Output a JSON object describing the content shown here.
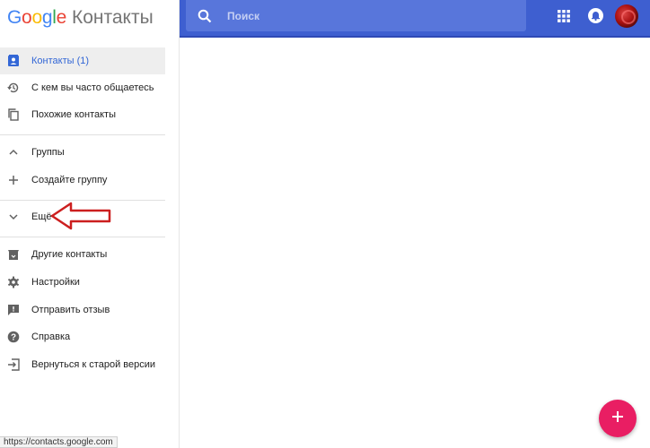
{
  "logo": {
    "letters": [
      {
        "ch": "G",
        "color": "#4285F4"
      },
      {
        "ch": "o",
        "color": "#EA4335"
      },
      {
        "ch": "o",
        "color": "#FBBC05"
      },
      {
        "ch": "g",
        "color": "#4285F4"
      },
      {
        "ch": "l",
        "color": "#34A853"
      },
      {
        "ch": "e",
        "color": "#EA4335"
      }
    ],
    "brand": "Google",
    "product": "Контакты"
  },
  "sidebar": {
    "items": [
      {
        "label": "Контакты (1)",
        "icon": "contacts-icon",
        "active": true
      },
      {
        "label": "С кем вы часто общаетесь",
        "icon": "history-icon"
      },
      {
        "label": "Похожие контакты",
        "icon": "copy-icon"
      },
      {
        "label": "Группы",
        "icon": "chevron-up-icon"
      },
      {
        "label": "Создайте группу",
        "icon": "plus-icon"
      },
      {
        "label": "Ещё",
        "icon": "chevron-down-icon"
      },
      {
        "label": "Другие контакты",
        "icon": "archive-icon"
      },
      {
        "label": "Настройки",
        "icon": "gear-icon"
      },
      {
        "label": "Отправить отзыв",
        "icon": "feedback-icon"
      },
      {
        "label": "Справка",
        "icon": "help-icon"
      },
      {
        "label": "Вернуться к старой версии",
        "icon": "exit-icon"
      }
    ]
  },
  "search": {
    "placeholder": "Поиск"
  },
  "topbar": {
    "apps_icon": "apps-grid-icon",
    "notifications_icon": "notifications-icon"
  },
  "fab": {
    "icon": "plus-icon"
  },
  "status_bar": {
    "url": "https://contacts.google.com"
  },
  "colors": {
    "topbar": "#3e5fd0",
    "search_bg": "#5876db",
    "fab": "#e91e63",
    "active_text": "#3367d6",
    "arrow": "#cc1f1f"
  }
}
